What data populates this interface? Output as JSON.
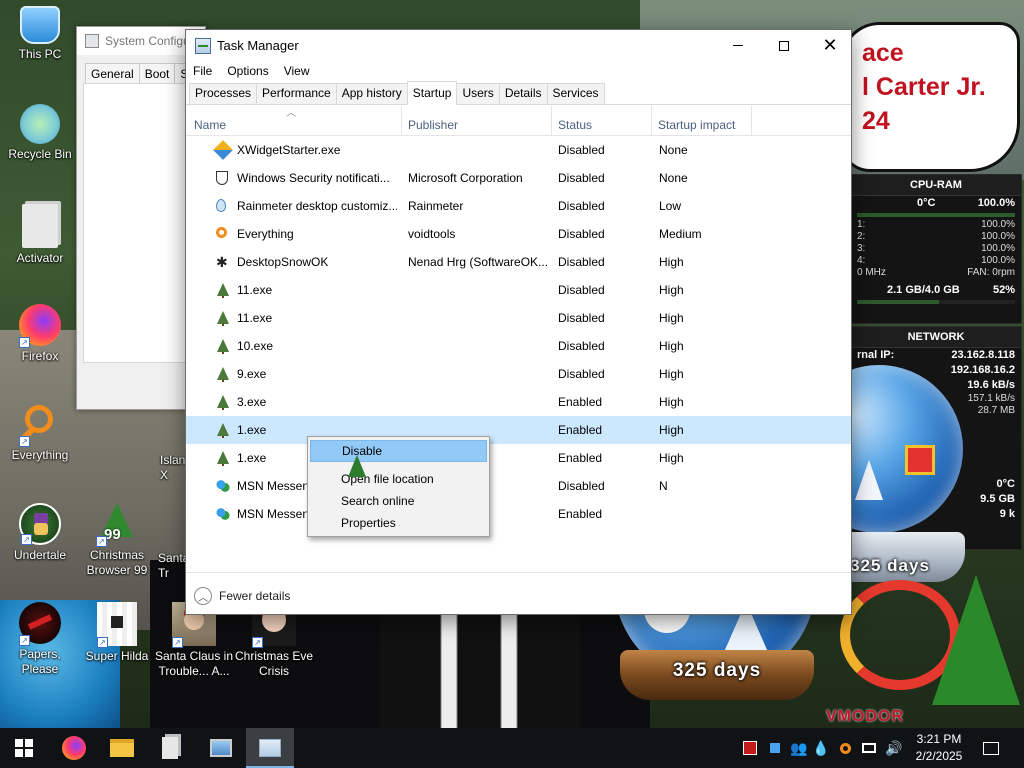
{
  "desktop": {
    "icons": [
      {
        "label": "This PC"
      },
      {
        "label": "Recycle Bin"
      },
      {
        "label": "Activator"
      },
      {
        "label": "Firefox"
      },
      {
        "label": "Everything"
      },
      {
        "label": "Undertale"
      },
      {
        "label": "Papers, Please"
      },
      {
        "label": "Christmas Browser 99"
      },
      {
        "label": "Super Hilda"
      },
      {
        "label": "Santa Claus in Trouble... A..."
      },
      {
        "label": "Christmas Eve Crisis"
      },
      {
        "label": "Islan X"
      },
      {
        "label": "Santa Tr"
      }
    ],
    "speech_bubble": [
      "ace",
      "l Carter Jr.",
      "24"
    ]
  },
  "gadgets": {
    "cpu": {
      "title": "CPU-RAM",
      "temp": "0°C",
      "total": "100.0%",
      "cores": [
        {
          "label": "1:",
          "value": "100.0%"
        },
        {
          "label": "2:",
          "value": "100.0%"
        },
        {
          "label": "3:",
          "value": "100.0%"
        },
        {
          "label": "4:",
          "value": "100.0%"
        }
      ],
      "freq": "0 MHz",
      "fan": "FAN: 0rpm",
      "ram": "2.1 GB/4.0 GB",
      "ram_pct": "52%"
    },
    "network": {
      "title": "NETWORK",
      "internal_label": "rnal IP:",
      "internal_ip": "23.162.8.118",
      "local_ip": "192.168.16.2",
      "rate1": "19.6 kB/s",
      "rate2": "157.1 kB/s",
      "total": "28.7 MB",
      "disk_temp": "0°C",
      "disk_size": "9.5 GB",
      "disk_k": "9 k"
    },
    "globes": {
      "label1": "325 days",
      "label2": "325 days",
      "brand": "VMODOR"
    }
  },
  "syscfg": {
    "title": "System Configu",
    "tabs": [
      "General",
      "Boot",
      "S"
    ]
  },
  "taskmgr": {
    "title": "Task Manager",
    "menu": [
      "File",
      "Options",
      "View"
    ],
    "tabs": [
      "Processes",
      "Performance",
      "App history",
      "Startup",
      "Users",
      "Details",
      "Services"
    ],
    "active_tab": "Startup",
    "columns": {
      "name": "Name",
      "publisher": "Publisher",
      "status": "Status",
      "impact": "Startup impact"
    },
    "rows": [
      {
        "name": "XWidgetStarter.exe",
        "publisher": "",
        "status": "Disabled",
        "impact": "None",
        "icon": "xwidget-icon"
      },
      {
        "name": "Windows Security notificati...",
        "publisher": "Microsoft Corporation",
        "status": "Disabled",
        "impact": "None",
        "icon": "shield-icon"
      },
      {
        "name": "Rainmeter desktop customiz...",
        "publisher": "Rainmeter",
        "status": "Disabled",
        "impact": "Low",
        "icon": "droplet-icon"
      },
      {
        "name": "Everything",
        "publisher": "voidtools",
        "status": "Disabled",
        "impact": "Medium",
        "icon": "magnifier-icon"
      },
      {
        "name": "DesktopSnowOK",
        "publisher": "Nenad Hrg (SoftwareOK...",
        "status": "Disabled",
        "impact": "High",
        "icon": "snowflake-icon"
      },
      {
        "name": "11.exe",
        "publisher": "",
        "status": "Disabled",
        "impact": "High",
        "icon": "tree-icon"
      },
      {
        "name": "11.exe",
        "publisher": "",
        "status": "Disabled",
        "impact": "High",
        "icon": "tree-icon"
      },
      {
        "name": "10.exe",
        "publisher": "",
        "status": "Disabled",
        "impact": "High",
        "icon": "tree-icon"
      },
      {
        "name": "9.exe",
        "publisher": "",
        "status": "Disabled",
        "impact": "High",
        "icon": "tree-icon"
      },
      {
        "name": "3.exe",
        "publisher": "",
        "status": "Enabled",
        "impact": "High",
        "icon": "tree-icon"
      },
      {
        "name": "1.exe",
        "publisher": "",
        "status": "Enabled",
        "impact": "High",
        "icon": "tree-icon"
      },
      {
        "name": "1.exe",
        "publisher": "",
        "status": "Enabled",
        "impact": "High",
        "icon": "tree-icon"
      },
      {
        "name": "MSN Messen",
        "publisher": "oration",
        "status": "Disabled",
        "impact": "N",
        "icon": "msn-icon"
      },
      {
        "name": "MSN Messen",
        "publisher": "oration",
        "status": "Enabled",
        "impact": "",
        "icon": "msn-icon"
      }
    ],
    "selected_row": 10,
    "fewer_details": "Fewer details"
  },
  "context_menu": {
    "items": [
      "Disable",
      "Open file location",
      "Search online",
      "Properties"
    ],
    "highlighted": "Disable"
  },
  "taskbar": {
    "clock_time": "3:21 PM",
    "clock_date": "2/2/2025"
  }
}
